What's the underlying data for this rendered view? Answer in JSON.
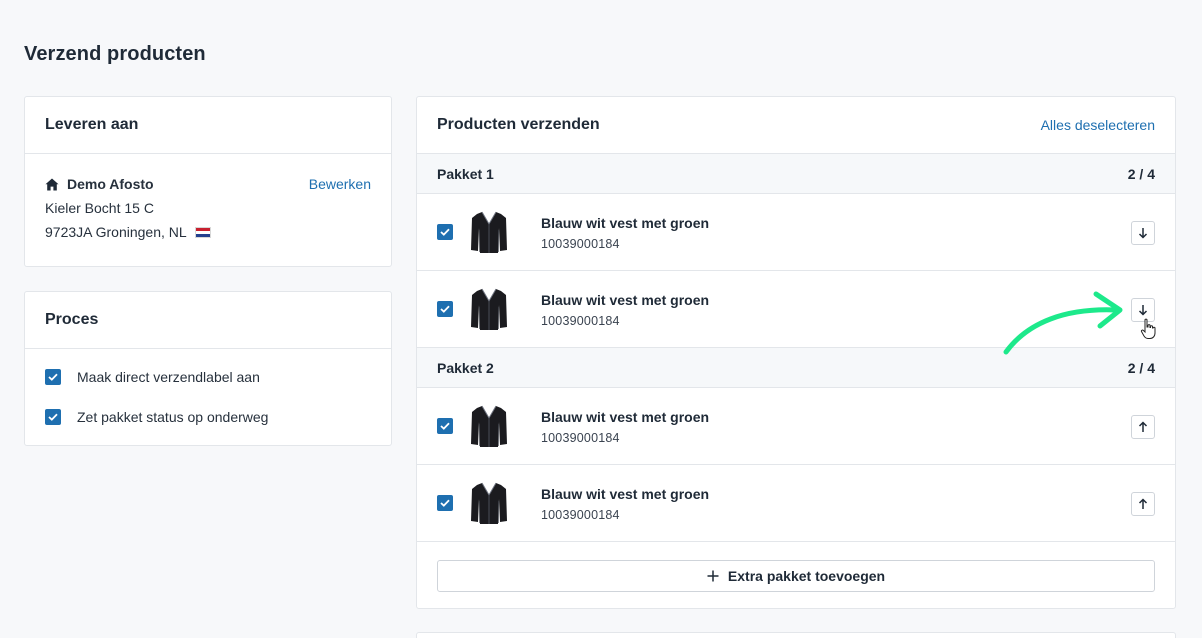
{
  "page": {
    "title": "Verzend producten"
  },
  "delivery": {
    "title": "Leveren aan",
    "icon": "home-icon",
    "name": "Demo Afosto",
    "edit_label": "Bewerken",
    "street": "Kieler Bocht 15 C",
    "city_line": "9723JA Groningen, NL",
    "flag": "netherlands-flag-icon"
  },
  "process": {
    "title": "Proces",
    "options": [
      {
        "label": "Maak direct verzendlabel aan",
        "checked": true
      },
      {
        "label": "Zet pakket status op onderweg",
        "checked": true
      }
    ]
  },
  "products": {
    "title": "Producten verzenden",
    "deselect_label": "Alles deselecteren",
    "packages": [
      {
        "label": "Pakket 1",
        "count": "2 / 4",
        "items": [
          {
            "name": "Blauw wit vest met groen",
            "sku": "10039000184",
            "checked": true,
            "move": "down"
          },
          {
            "name": "Blauw wit vest met groen",
            "sku": "10039000184",
            "checked": true,
            "move": "down"
          }
        ]
      },
      {
        "label": "Pakket 2",
        "count": "2 / 4",
        "items": [
          {
            "name": "Blauw wit vest met groen",
            "sku": "10039000184",
            "checked": true,
            "move": "up"
          },
          {
            "name": "Blauw wit vest met groen",
            "sku": "10039000184",
            "checked": true,
            "move": "up"
          }
        ]
      }
    ],
    "add_package_label": "Extra pakket toevoegen"
  },
  "colors": {
    "accent": "#1e6fb0",
    "annotation_arrow": "#1de98b"
  }
}
